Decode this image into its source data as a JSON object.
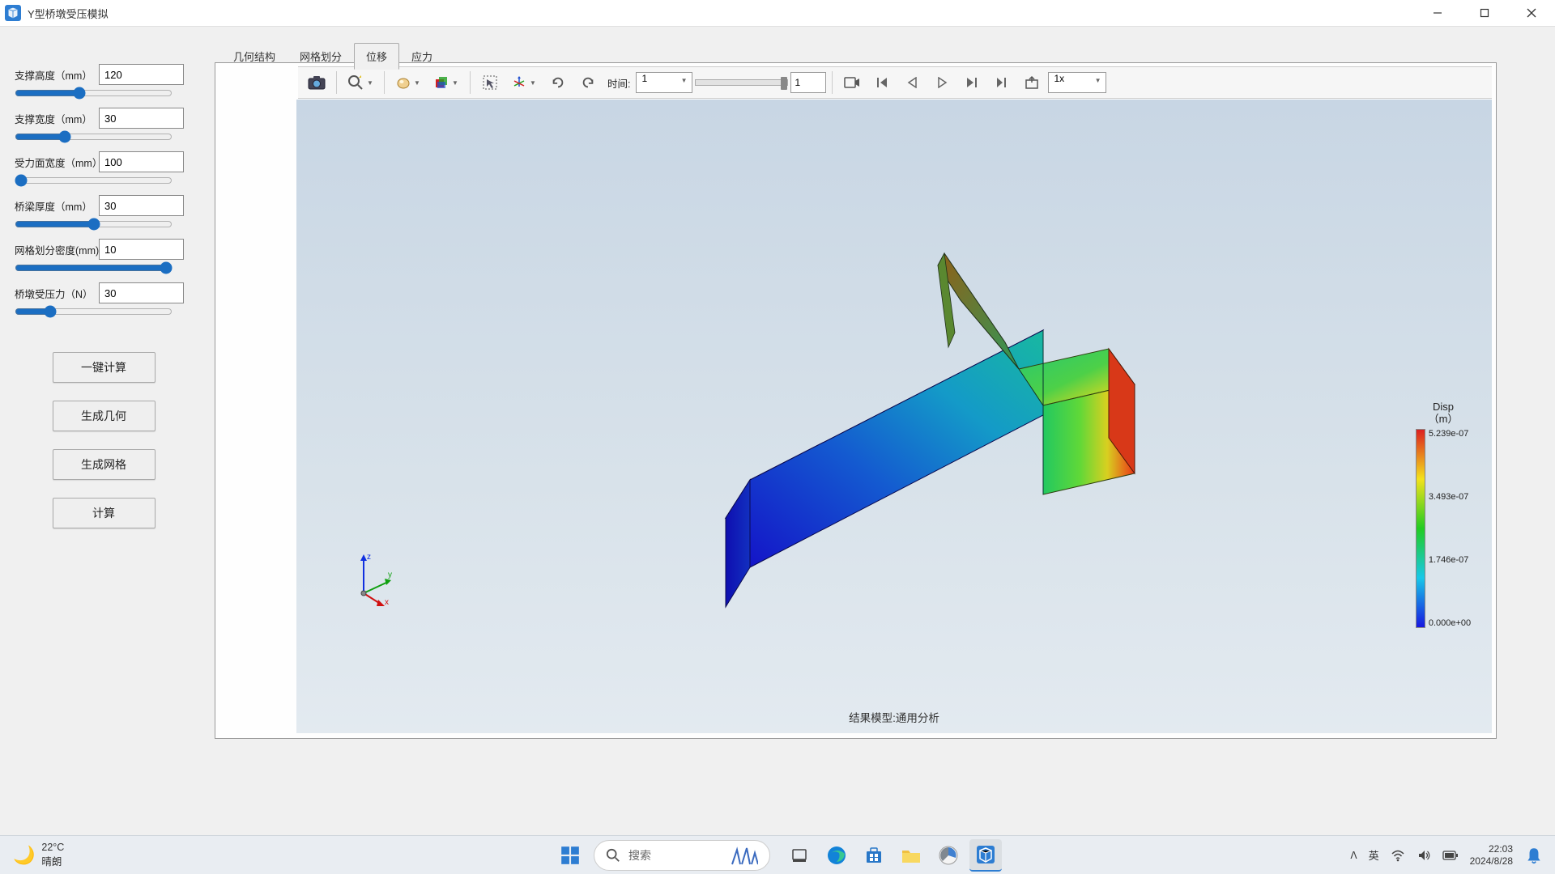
{
  "window": {
    "title": "Y型桥墩受压模拟"
  },
  "params": {
    "p1": {
      "label": "支撑高度（mm）",
      "value": "120"
    },
    "p2": {
      "label": "支撑宽度（mm）",
      "value": "30"
    },
    "p3": {
      "label": "受力面宽度（mm）",
      "value": "100"
    },
    "p4": {
      "label": "桥梁厚度（mm）",
      "value": "30"
    },
    "p5": {
      "label": "网格划分密度(mm)",
      "value": "10"
    },
    "p6": {
      "label": "桥墩受压力（N）",
      "value": "30"
    }
  },
  "buttons": {
    "one_click": "一键计算",
    "gen_geom": "生成几何",
    "gen_mesh": "生成网格",
    "compute": "计算"
  },
  "tabs": {
    "t1": "几何结构",
    "t2": "网格划分",
    "t3": "位移",
    "t4": "应力"
  },
  "toolbar": {
    "time_label": "时间:",
    "time_select": "1",
    "time_spinner": "1",
    "speed_select": "1x"
  },
  "legend": {
    "title1": "Disp",
    "title2": "（m）",
    "v4": "5.239e-07",
    "v3": "3.493e-07",
    "v2": "1.746e-07",
    "v1": "0.000e+00"
  },
  "viewport": {
    "caption": "结果模型:通用分析"
  },
  "triad": {
    "x": "x",
    "y": "y",
    "z": "z"
  },
  "taskbar": {
    "temp": "22°C",
    "cond": "晴朗",
    "search": "搜索",
    "ime1": "英",
    "time": "22:03",
    "date": "2024/8/28",
    "chevron": "ㅅ"
  },
  "chart_data": {
    "type": "colorbar",
    "title": "Disp (m)",
    "range": [
      0.0,
      5.239e-07
    ],
    "ticks": [
      0.0,
      1.746e-07,
      3.493e-07,
      5.239e-07
    ],
    "colormap": "rainbow"
  }
}
